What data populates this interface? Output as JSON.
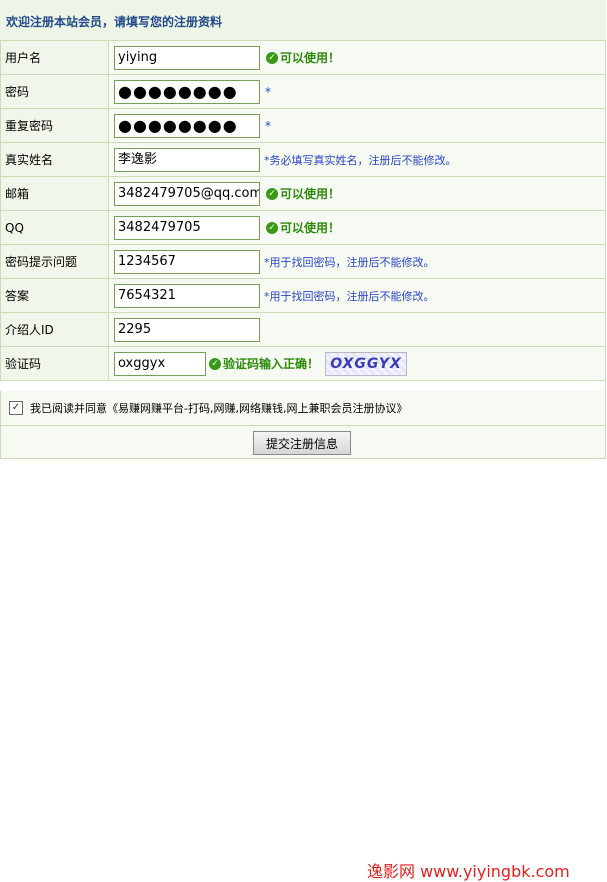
{
  "header": {
    "title": "欢迎注册本站会员，请填写您的注册资料"
  },
  "fields": {
    "username": {
      "label": "用户名",
      "value": "yiying",
      "status": "可以使用！"
    },
    "password": {
      "label": "密码",
      "value": "●●●●●●●●",
      "mark": "*"
    },
    "confirm_password": {
      "label": "重复密码",
      "value": "●●●●●●●●",
      "mark": "*"
    },
    "real_name": {
      "label": "真实姓名",
      "value": "李逸影",
      "hint": "*务必填写真实姓名，注册后不能修改。"
    },
    "email": {
      "label": "邮箱",
      "value": "3482479705@qq.com",
      "status": "可以使用！"
    },
    "qq": {
      "label": "QQ",
      "value": "3482479705",
      "status": "可以使用！"
    },
    "security_question": {
      "label": "密码提示问题",
      "value": "1234567",
      "hint": "*用于找回密码，注册后不能修改。"
    },
    "answer": {
      "label": "答案",
      "value": "7654321",
      "hint": "*用于找回密码，注册后不能修改。"
    },
    "referrer_id": {
      "label": "介绍人ID",
      "value": "2295"
    },
    "captcha": {
      "label": "验证码",
      "value": "oxggyx",
      "status": "验证码输入正确！",
      "image_text": "OXGGYX"
    }
  },
  "agreement": {
    "checked": true,
    "text": "我已阅读并同意《易赚网赚平台-打码,网赚,网络赚钱,网上兼职会员注册协议》"
  },
  "submit": {
    "label": "提交注册信息"
  },
  "watermark": {
    "text": "逸影网 www.yiyingbk.com"
  },
  "icons": {
    "ok": "check-circle-icon",
    "checkbox": "checkbox-checked-icon"
  },
  "colors": {
    "ok_green": "#2e8a0c",
    "hint_blue": "#2b45c9",
    "header_blue": "#244a8a",
    "watermark_red": "#e81e1e",
    "border_green": "#c9dcb7"
  }
}
